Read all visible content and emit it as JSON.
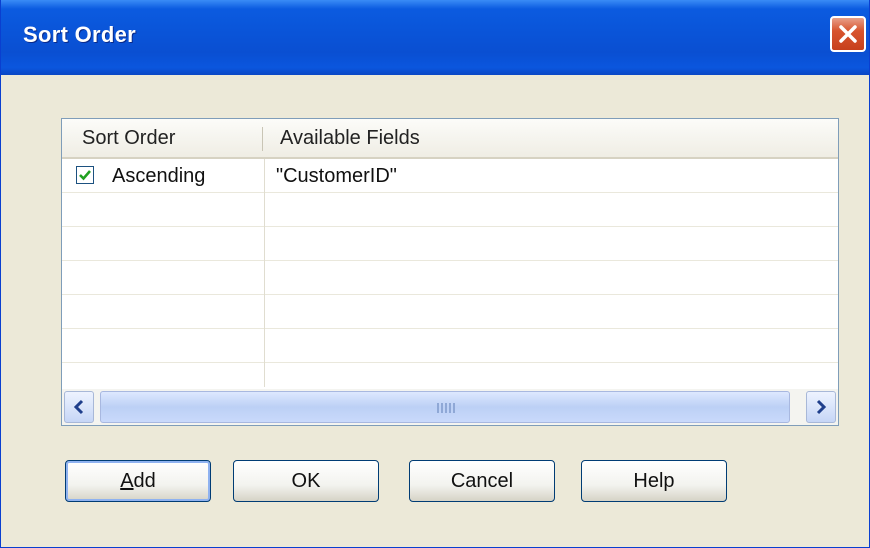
{
  "window": {
    "title": "Sort Order"
  },
  "grid": {
    "columns": [
      "Sort Order",
      "Available Fields"
    ],
    "rows": [
      {
        "checked": true,
        "sort_order": "Ascending",
        "field": "\"CustomerID\""
      },
      {
        "checked": false,
        "sort_order": "",
        "field": ""
      },
      {
        "checked": false,
        "sort_order": "",
        "field": ""
      },
      {
        "checked": false,
        "sort_order": "",
        "field": ""
      },
      {
        "checked": false,
        "sort_order": "",
        "field": ""
      },
      {
        "checked": false,
        "sort_order": "",
        "field": ""
      },
      {
        "checked": false,
        "sort_order": "",
        "field": ""
      }
    ]
  },
  "buttons": {
    "add": {
      "mnemonic": "A",
      "rest": "dd"
    },
    "ok": "OK",
    "cancel": "Cancel",
    "help": "Help"
  },
  "icons": {
    "close": "close-icon",
    "check": "checkmark-icon",
    "left": "arrow-left-icon",
    "right": "arrow-right-icon"
  },
  "colors": {
    "titlebar": "#0a54d8",
    "close": "#d8542e",
    "check": "#21a121"
  }
}
